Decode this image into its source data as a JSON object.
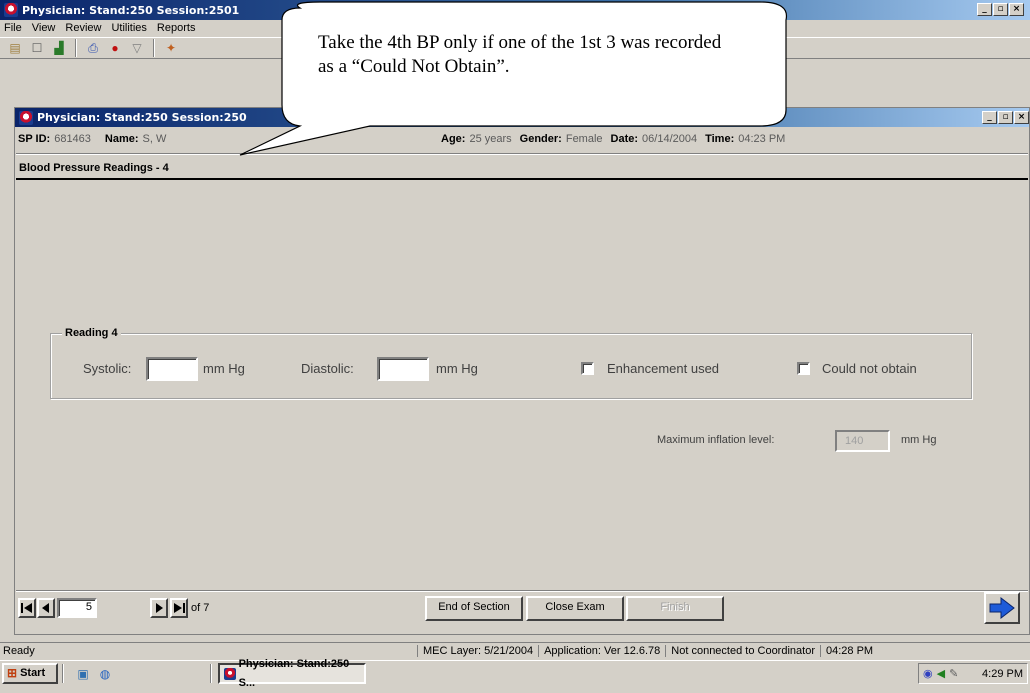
{
  "app": {
    "title": "Physician: Stand:250 Session:2501",
    "menu": [
      "File",
      "View",
      "Review",
      "Utilities",
      "Reports"
    ],
    "toolbar_icons": [
      "open-icon",
      "new-icon",
      "save-icon",
      "print-icon",
      "record-icon",
      "filter-icon",
      "people-icon"
    ]
  },
  "child_window": {
    "title": "Physician: Stand:250 Session:250"
  },
  "patient": {
    "sp_id_label": "SP ID:",
    "sp_id": "681463",
    "name_label": "Name:",
    "name": "S, W",
    "age_label": "Age:",
    "age": "25 years",
    "gender_label": "Gender:",
    "gender": "Female",
    "date_label": "Date:",
    "date": "06/14/2004",
    "time_label": "Time:",
    "time": "04:23 PM"
  },
  "section": {
    "title": "Blood Pressure Readings - 4"
  },
  "reading": {
    "group_title": "Reading 4",
    "systolic_label": "Systolic:",
    "systolic_value": "",
    "systolic_unit": "mm Hg",
    "diastolic_label": "Diastolic:",
    "diastolic_value": "",
    "diastolic_unit": "mm Hg",
    "enhancement_label": "Enhancement used",
    "enhancement_checked": false,
    "could_not_obtain_label": "Could not obtain",
    "could_not_obtain_checked": false
  },
  "inflation": {
    "label": "Maximum inflation level:",
    "value": "140",
    "unit": "mm Hg"
  },
  "navigation": {
    "current_page": "5",
    "of_label": "of 7",
    "end_of_section": "End of Section",
    "close_exam": "Close Exam",
    "finish": "Finish"
  },
  "status": {
    "ready": "Ready",
    "mec_layer": "MEC Layer: 5/21/2004",
    "application": "Application: Ver 12.6.78",
    "connection": "Not connected to Coordinator",
    "time": "04:28 PM"
  },
  "taskbar": {
    "start": "Start",
    "task_button": "Physician: Stand:250 S...",
    "clock": "4:29 PM"
  },
  "callout": {
    "text": "Take the 4th BP only if one of the 1st 3 was recorded as a “Could Not Obtain”."
  },
  "colors": {
    "titlebar_start": "#0a246a",
    "titlebar_end": "#a6caf0",
    "window_bg": "#d4d0c8",
    "nav_arrow": "#1e5bd8"
  }
}
